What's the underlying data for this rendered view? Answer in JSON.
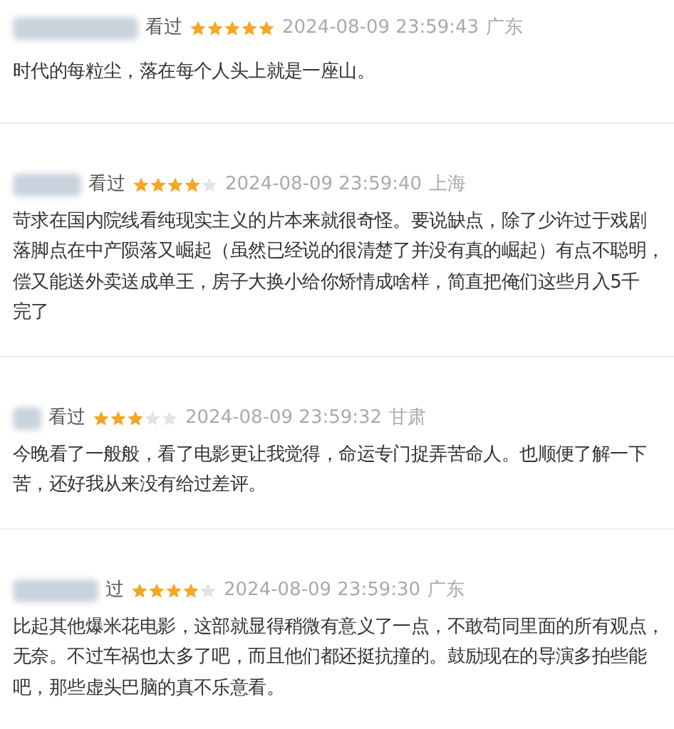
{
  "reviews": [
    {
      "watched": "看过",
      "stars": 5,
      "time": "2024-08-09 23:59:43",
      "region": "广东",
      "lines": [
        "时代的每粒尘，落在每个人头上就是一座山。"
      ]
    },
    {
      "watched": "看过",
      "stars": 4,
      "time": "2024-08-09 23:59:40",
      "region": "上海",
      "lines": [
        "苛求在国内院线看纯现实主义的片本来就很奇怪。要说缺点，除了少许过于戏剧",
        "落脚点在中产陨落又崛起（虽然已经说的很清楚了并没有真的崛起）有点不聪明，",
        "偿又能送外卖送成单王，房子大换小给你矫情成啥样，简直把俺们这些月入5千",
        "完了"
      ]
    },
    {
      "watched": "看过",
      "stars": 3,
      "time": "2024-08-09 23:59:32",
      "region": "甘肃",
      "lines": [
        "今晚看了一般般，看了电影更让我觉得，命运专门捉弄苦命人。也顺便了解一下",
        "苦，还好我从来没有给过差评。"
      ]
    },
    {
      "watched": "过",
      "stars": 4,
      "time": "2024-08-09 23:59:30",
      "region": "广东",
      "lines": [
        "比起其他爆米花电影，这部就显得稍微有意义了一点，不敢苟同里面的所有观点，",
        "无奈。不过车祸也太多了吧，而且他们都还挺抗撞的。鼓励现在的导演多拍些能",
        "吧，那些虚头巴脑的真不乐意看。"
      ]
    }
  ]
}
